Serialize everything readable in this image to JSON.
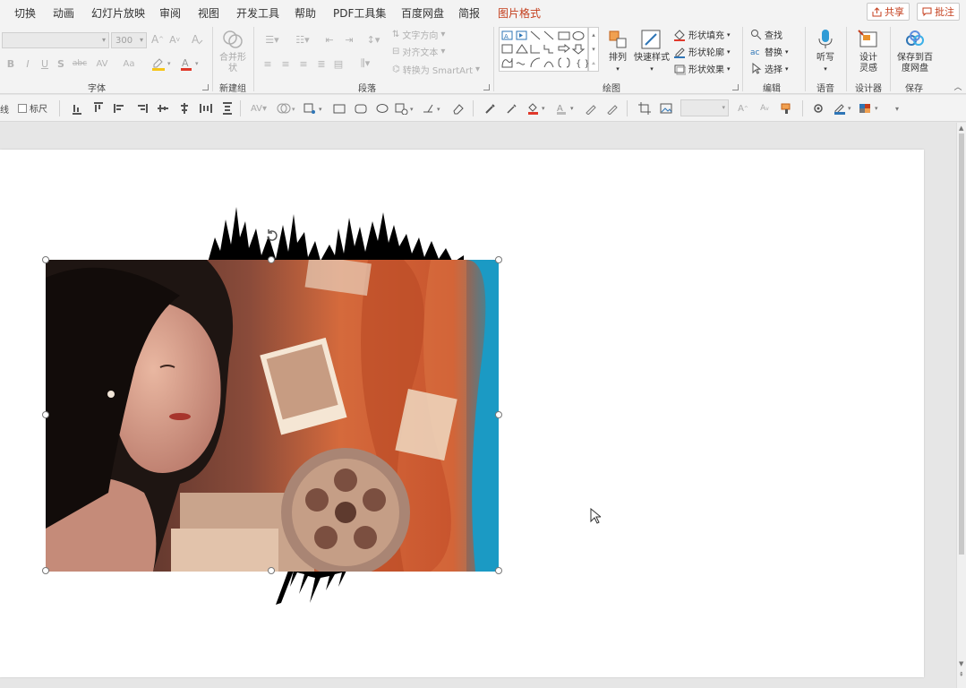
{
  "tabs": [
    "切换",
    "动画",
    "幻灯片放映",
    "审阅",
    "视图",
    "开发工具",
    "帮助",
    "PDF工具集",
    "百度网盘",
    "简报",
    "图片格式"
  ],
  "active_tab": "图片格式",
  "top_buttons": {
    "share": "共享",
    "comment": "批注"
  },
  "font_group": {
    "font_size_placeholder": "300",
    "label": "字体",
    "buttons": [
      "B",
      "I",
      "U",
      "S",
      "abc",
      "AV",
      "Aa"
    ]
  },
  "merge_group": {
    "merge_shapes": "合并形状",
    "label": "新建组"
  },
  "paragraph_group": {
    "text_direction": "文字方向",
    "align_text": "对齐文本",
    "convert_smartart": "转换为 SmartArt",
    "label": "段落"
  },
  "drawing_group": {
    "arrange": "排列",
    "quick_styles": "快速样式",
    "shape_fill": "形状填充",
    "shape_outline": "形状轮廓",
    "shape_effects": "形状效果",
    "label": "绘图"
  },
  "editing_group": {
    "find": "查找",
    "replace": "替换",
    "select": "选择",
    "label": "编辑"
  },
  "voice_group": {
    "dictate": "听写",
    "label": "语音"
  },
  "designer_group": {
    "design_ideas": "设计灵感",
    "label": "设计器"
  },
  "save_group": {
    "save_to_baidu": "保存到百度网盘",
    "label": "保存"
  },
  "toolbar2": {
    "gridline_label": "线",
    "ruler_label": "标尺"
  },
  "colors": {
    "accent": "#c43e1c",
    "ribbon_bg": "#f3f3f3",
    "slide_bg": "#ffffff",
    "canvas_bg": "#e6e6e6"
  },
  "slide": {
    "image_name": "photo-woman-film-projector",
    "brush_stroke": "black-ink-brush-stroke"
  }
}
